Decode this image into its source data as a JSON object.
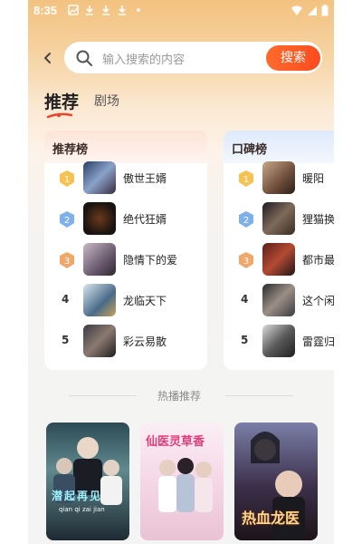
{
  "status_bar": {
    "time": "8:35"
  },
  "search": {
    "placeholder": "输入搜索的内容",
    "button_label": "搜索",
    "clear_symbol": "×"
  },
  "tabs": [
    {
      "label": "推荐",
      "active": true
    },
    {
      "label": "剧场",
      "active": false
    }
  ],
  "rank_lists": [
    {
      "title": "推荐榜",
      "accent": "#f3a243",
      "items": [
        {
          "rank": "1",
          "name": "傲世王婿"
        },
        {
          "rank": "2",
          "name": "绝代狂婿"
        },
        {
          "rank": "3",
          "name": "隐情下的爱"
        },
        {
          "rank": "4",
          "name": "龙临天下"
        },
        {
          "rank": "5",
          "name": "彩云易散"
        }
      ]
    },
    {
      "title": "口碑榜",
      "accent": "#4a8de6",
      "items": [
        {
          "rank": "1",
          "name": "暖阳"
        },
        {
          "rank": "2",
          "name": "狸猫换"
        },
        {
          "rank": "3",
          "name": "都市最"
        },
        {
          "rank": "4",
          "name": "这个闲"
        },
        {
          "rank": "5",
          "name": "雷霆归"
        }
      ]
    }
  ],
  "hot_section": {
    "label": "热播推荐",
    "posters": [
      {
        "title_art": "潜起再见",
        "pinyin": "qian qi zai jian"
      },
      {
        "title_art": "仙医灵草香"
      },
      {
        "title_art": "热血龙医"
      }
    ]
  }
}
